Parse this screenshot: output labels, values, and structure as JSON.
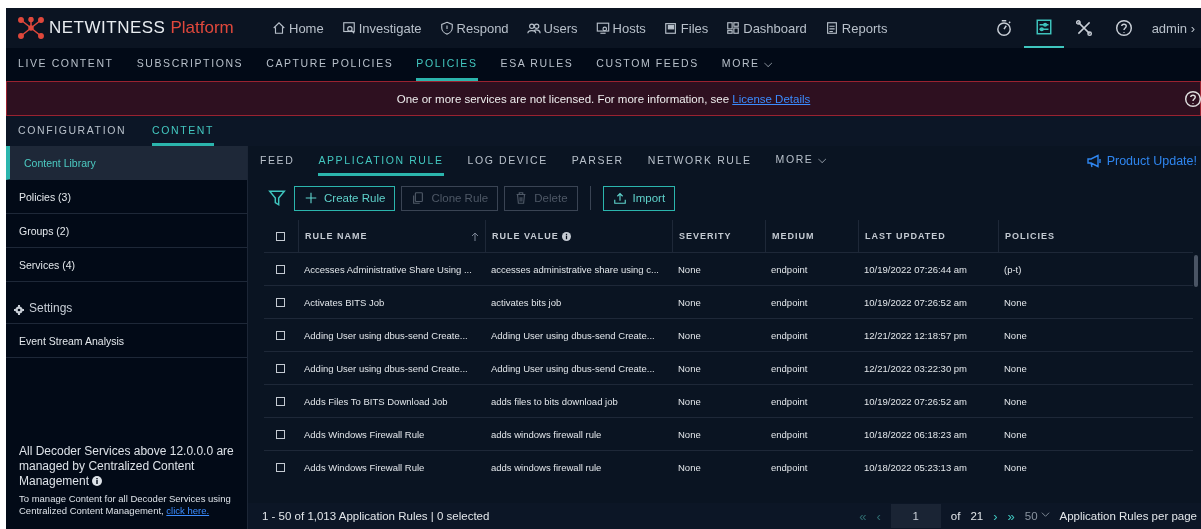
{
  "brand": {
    "name": "NETWITNESS",
    "product": "Platform"
  },
  "nav": [
    {
      "label": "Home"
    },
    {
      "label": "Investigate"
    },
    {
      "label": "Respond"
    },
    {
      "label": "Users"
    },
    {
      "label": "Hosts"
    },
    {
      "label": "Files"
    },
    {
      "label": "Dashboard"
    },
    {
      "label": "Reports"
    }
  ],
  "tool_icons": [
    {
      "selected": false
    },
    {
      "selected": true
    },
    {
      "selected": false
    },
    {
      "selected": false
    }
  ],
  "user": "admin ›",
  "subnav": [
    {
      "label": "LIVE CONTENT",
      "selected": false
    },
    {
      "label": "SUBSCRIPTIONS",
      "selected": false
    },
    {
      "label": "CAPTURE POLICIES",
      "selected": false
    },
    {
      "label": "POLICIES",
      "selected": true
    },
    {
      "label": "ESA RULES",
      "selected": false
    },
    {
      "label": "CUSTOM FEEDS",
      "selected": false
    },
    {
      "label": "MORE ⌵",
      "selected": false
    }
  ],
  "banner": {
    "text": "One or more services are not licensed. For more information, see ",
    "link": "License Details"
  },
  "config_tabs": [
    {
      "label": "CONFIGURATION",
      "selected": false
    },
    {
      "label": "CONTENT",
      "selected": true
    }
  ],
  "sidebar": {
    "items": [
      {
        "label": "Content Library",
        "selected": true
      },
      {
        "label": "Policies (3)",
        "selected": false
      },
      {
        "label": "Groups (2)",
        "selected": false
      },
      {
        "label": "Services (4)",
        "selected": false
      }
    ],
    "settings": "Settings",
    "settings_items": [
      {
        "label": "Event Stream Analysis",
        "selected": false
      }
    ],
    "note_title": "All Decoder Services above 12.0.0.0 are managed by Centralized Content Management",
    "note_text": "To manage Content for all Decoder Services using Centralized Content Management, ",
    "note_link": "click here."
  },
  "rule_tabs": [
    {
      "label": "FEED",
      "selected": false
    },
    {
      "label": "APPLICATION RULE",
      "selected": true
    },
    {
      "label": "LOG DEVICE",
      "selected": false
    },
    {
      "label": "PARSER",
      "selected": false
    },
    {
      "label": "NETWORK RULE",
      "selected": false
    },
    {
      "label": "MORE ⌵",
      "selected": false
    }
  ],
  "product_update": "Product Update!",
  "toolbar": [
    {
      "label": "Create Rule",
      "disabled": false
    },
    {
      "label": "Clone Rule",
      "disabled": true
    },
    {
      "label": "Delete",
      "disabled": true
    },
    {
      "label": "Import",
      "disabled": false
    }
  ],
  "table": {
    "select_all_checked": false,
    "columns": [
      "RULE NAME",
      "RULE VALUE",
      "SEVERITY",
      "MEDIUM",
      "LAST UPDATED",
      "POLICIES"
    ],
    "rows": [
      {
        "checked": false,
        "cells": [
          "Accesses Administrative Share Using ...",
          "accesses administrative share using c...",
          "None",
          "endpoint",
          "10/19/2022 07:26:44 am",
          "(p-t)"
        ]
      },
      {
        "checked": false,
        "cells": [
          "Activates BITS Job",
          "activates bits job",
          "None",
          "endpoint",
          "10/19/2022 07:26:52 am",
          "None"
        ]
      },
      {
        "checked": false,
        "cells": [
          "Adding User using dbus-send Create...",
          "Adding User using dbus-send Create...",
          "None",
          "endpoint",
          "12/21/2022 12:18:57 pm",
          "None"
        ]
      },
      {
        "checked": false,
        "cells": [
          "Adding User using dbus-send Create...",
          "Adding User using dbus-send Create...",
          "None",
          "endpoint",
          "12/21/2022 03:22:30 pm",
          "None"
        ]
      },
      {
        "checked": false,
        "cells": [
          "Adds Files To BITS Download Job",
          "adds files to bits download job",
          "None",
          "endpoint",
          "10/19/2022 07:26:52 am",
          "None"
        ]
      },
      {
        "checked": false,
        "cells": [
          "Adds Windows Firewall Rule",
          "adds windows firewall rule",
          "None",
          "endpoint",
          "10/18/2022 06:18:23 am",
          "None"
        ]
      },
      {
        "checked": false,
        "cells": [
          "Adds Windows Firewall Rule",
          "adds windows firewall rule",
          "None",
          "endpoint",
          "10/18/2022 05:23:13 am",
          "None"
        ]
      }
    ]
  },
  "footer": {
    "summary": "1 - 50 of 1,013 Application Rules | 0 selected",
    "first": "«",
    "prev": "‹",
    "next": "›",
    "last": "»",
    "page": "1",
    "of": "of",
    "total": "21",
    "per_page": "50",
    "per_page_label": "Application Rules per page"
  }
}
